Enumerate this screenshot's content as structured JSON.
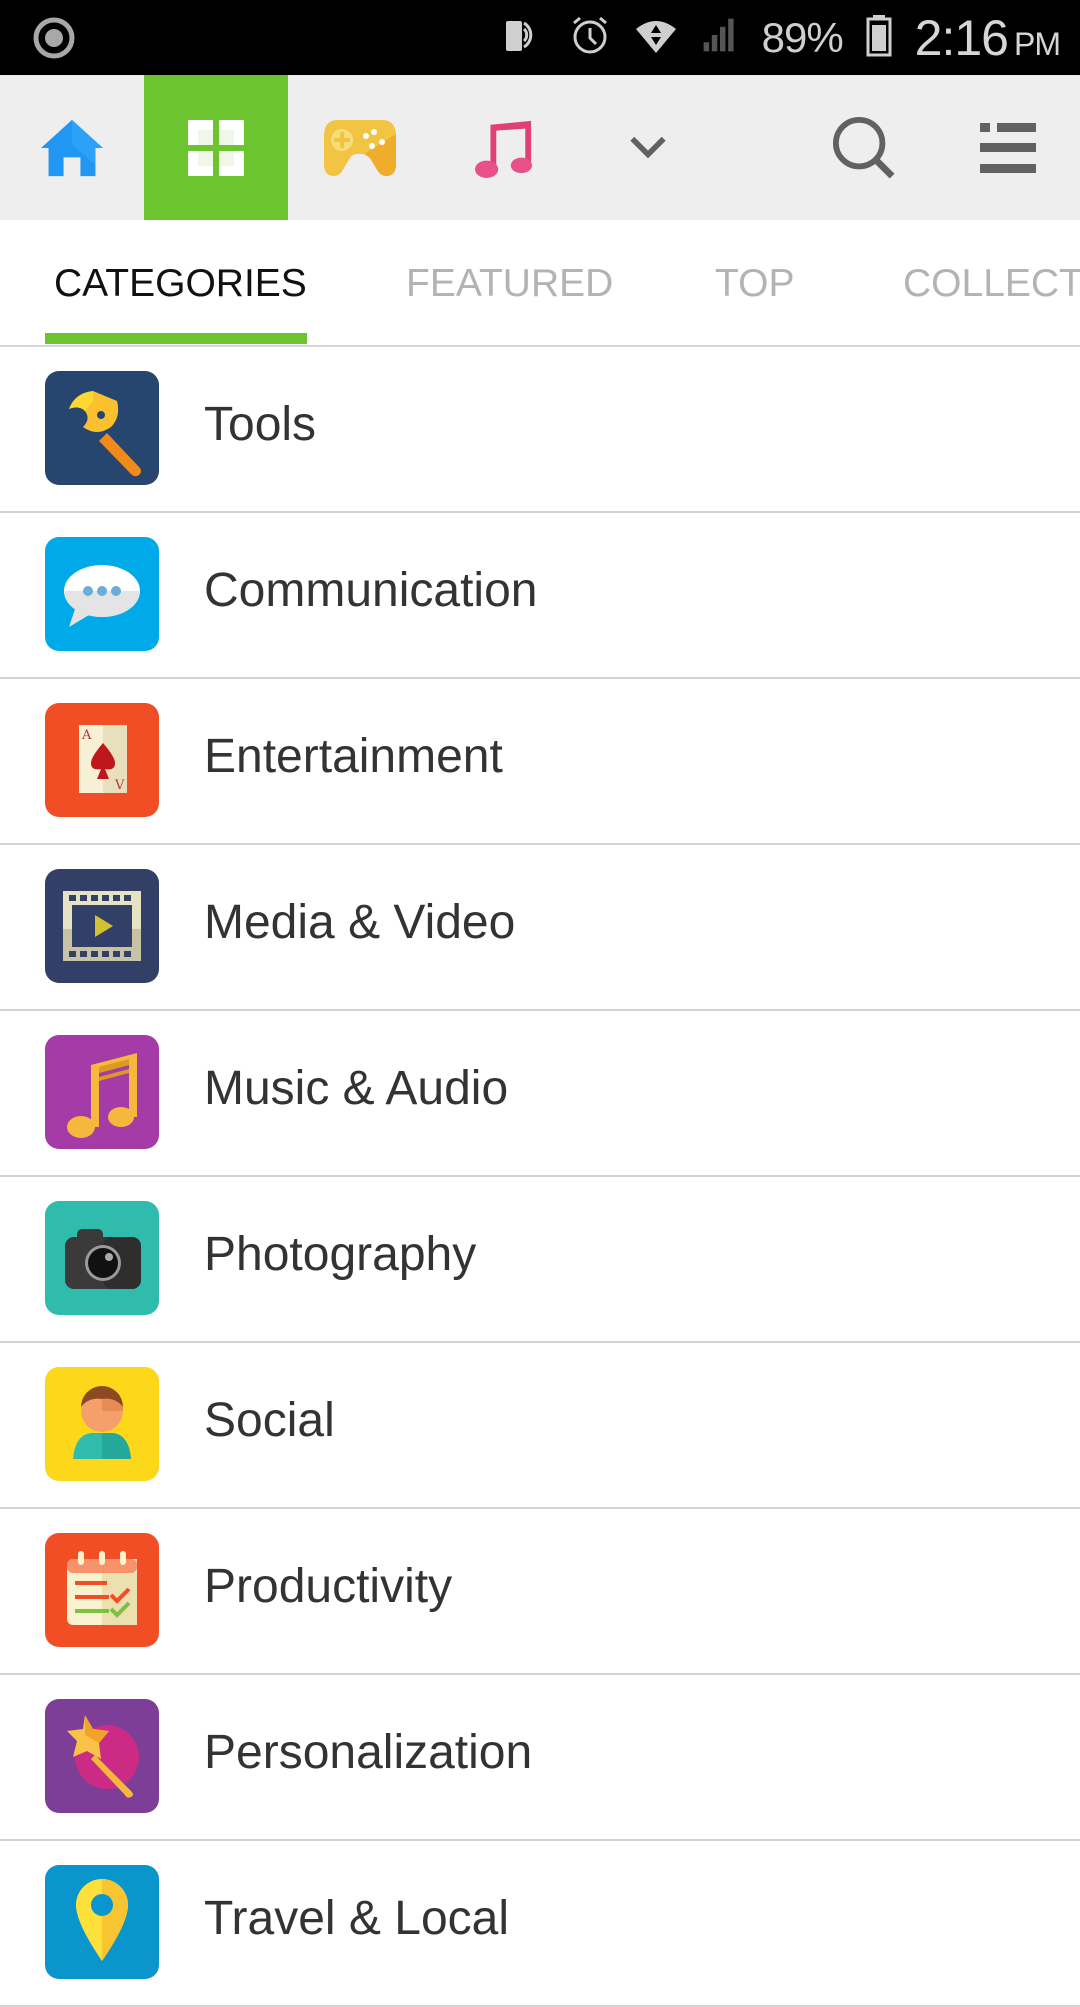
{
  "status_bar": {
    "left_icon": "record-icon",
    "icons": [
      "nfc-payment-icon",
      "alarm-icon",
      "wifi-icon",
      "cell-signal-icon"
    ],
    "battery_percent": "89%",
    "battery_icon": "battery-icon",
    "time": "2:16",
    "ampm": "PM"
  },
  "toolbar": {
    "buttons": [
      {
        "name": "home",
        "icon": "home-icon",
        "color": "#2196f3",
        "active": false
      },
      {
        "name": "apps",
        "icon": "grid-icon",
        "color": "#ffffff",
        "active": true
      },
      {
        "name": "games",
        "icon": "gamepad-icon",
        "color": "#f2c443",
        "active": false
      },
      {
        "name": "music",
        "icon": "music-note-icon",
        "color": "#e8508a",
        "active": false
      },
      {
        "name": "more",
        "icon": "chevron-down-icon",
        "color": "#616161",
        "active": false
      },
      {
        "name": "search",
        "icon": "search-icon",
        "color": "#616161",
        "active": false
      },
      {
        "name": "menu",
        "icon": "list-menu-icon",
        "color": "#616161",
        "active": false
      }
    ],
    "accent": "#6cc42f"
  },
  "tabs": [
    {
      "label": "CATEGORIES",
      "active": true
    },
    {
      "label": "FEATURED",
      "active": false
    },
    {
      "label": "TOP",
      "active": false
    },
    {
      "label": "COLLECT",
      "active": false
    }
  ],
  "categories": [
    {
      "label": "Tools",
      "icon": "wrench-icon",
      "bg": "#27466f"
    },
    {
      "label": "Communication",
      "icon": "chat-bubble-icon",
      "bg": "#00a9e8"
    },
    {
      "label": "Entertainment",
      "icon": "playing-card-icon",
      "bg": "#f24e26"
    },
    {
      "label": "Media & Video",
      "icon": "film-play-icon",
      "bg": "#323f66"
    },
    {
      "label": "Music & Audio",
      "icon": "music-notes-icon",
      "bg": "#a53ba6"
    },
    {
      "label": "Photography",
      "icon": "camera-icon",
      "bg": "#2fbcad"
    },
    {
      "label": "Social",
      "icon": "person-icon",
      "bg": "#fdd719"
    },
    {
      "label": "Productivity",
      "icon": "checklist-calendar-icon",
      "bg": "#f24e26"
    },
    {
      "label": "Personalization",
      "icon": "magic-wand-icon",
      "bg": "#7c3e96"
    },
    {
      "label": "Travel & Local",
      "icon": "location-pin-icon",
      "bg": "#0a96cc"
    }
  ]
}
